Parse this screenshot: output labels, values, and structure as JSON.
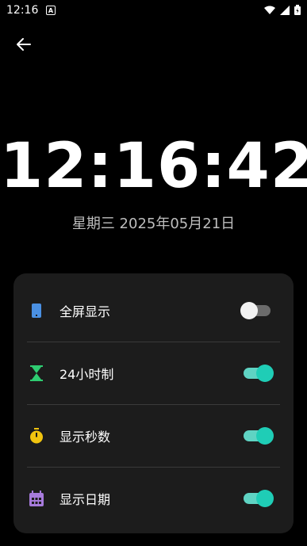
{
  "status_bar": {
    "time": "12:16",
    "notification_glyph": "A"
  },
  "clock": {
    "time": "12:16:42",
    "date": "星期三 2025年05月21日"
  },
  "settings": [
    {
      "label": "全屏显示",
      "icon": "phone-icon",
      "color": "#4a90e2",
      "enabled": false
    },
    {
      "label": "24小时制",
      "icon": "hourglass-icon",
      "color": "#2ecc71",
      "enabled": true
    },
    {
      "label": "显示秒数",
      "icon": "stopwatch-icon",
      "color": "#f1c40f",
      "enabled": true
    },
    {
      "label": "显示日期",
      "icon": "calendar-icon",
      "color": "#a77bdc",
      "enabled": true
    }
  ],
  "colors": {
    "background": "#000000",
    "card": "#1c1c1c",
    "accent": "#1fcdb6"
  }
}
